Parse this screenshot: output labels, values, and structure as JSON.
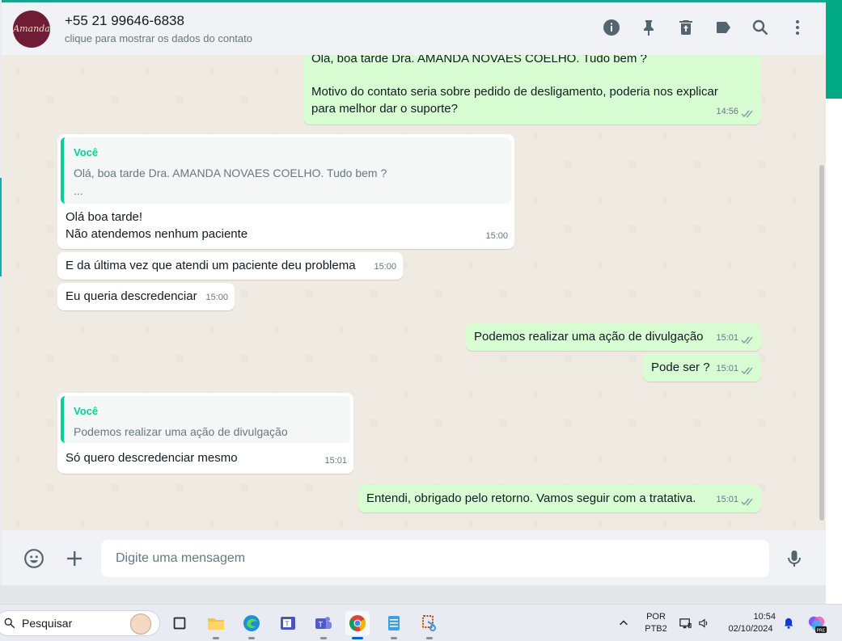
{
  "header": {
    "avatar_text": "Amanda",
    "contact_name": "+55 21 99646-6838",
    "contact_subtitle": "clique para mostrar os dados do contato"
  },
  "messages": [
    {
      "id": "m1",
      "direction": "outgoing",
      "line1": "Olá, boa tarde Dra. AMANDA NOVAES COELHO. Tudo bem ?",
      "line2": "Motivo do contato seria sobre pedido de desligamento, poderia nos explicar",
      "line3": "para melhor dar o suporte?",
      "time": "14:56"
    },
    {
      "id": "m2",
      "direction": "incoming",
      "quote_author": "Você",
      "quote_line1": "Olá, boa tarde Dra. AMANDA NOVAES COELHO. Tudo bem ?",
      "quote_line2": "...",
      "line1": "Olá boa tarde!",
      "line2": "Não atendemos nenhum paciente",
      "time": "15:00"
    },
    {
      "id": "m3",
      "direction": "incoming",
      "text": "E da última vez que atendi um paciente deu problema",
      "time": "15:00"
    },
    {
      "id": "m4",
      "direction": "incoming",
      "text": "Eu queria descredenciar",
      "time": "15:00"
    },
    {
      "id": "m5",
      "direction": "outgoing",
      "text": "Podemos realizar uma ação de divulgação",
      "time": "15:01"
    },
    {
      "id": "m6",
      "direction": "outgoing",
      "text": "Pode ser ?",
      "time": "15:01"
    },
    {
      "id": "m7",
      "direction": "incoming",
      "quote_author": "Você",
      "quote_text": "Podemos realizar uma ação de divulgação",
      "text": "Só quero descredenciar mesmo",
      "time": "15:01"
    },
    {
      "id": "m8",
      "direction": "outgoing",
      "text": "Entendi, obrigado pelo retorno. Vamos seguir com a tratativa.",
      "time": "15:01"
    }
  ],
  "compose": {
    "placeholder": "Digite uma mensagem"
  },
  "taskbar": {
    "search_label": "Pesquisar",
    "language": "POR",
    "keyboard": "PTB2",
    "time": "10:54",
    "date": "02/10/2024",
    "copilot_badge": "PRE"
  }
}
